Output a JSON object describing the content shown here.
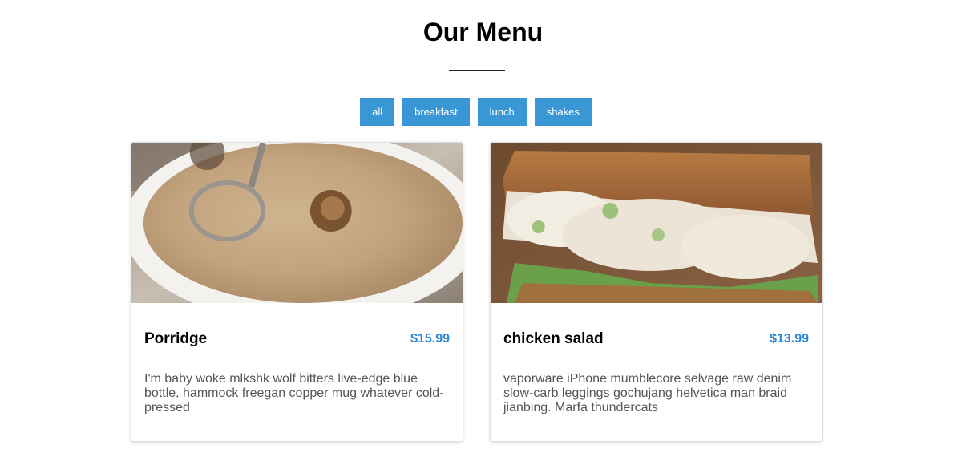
{
  "header": {
    "title": "Our Menu"
  },
  "filters": [
    {
      "label": "all"
    },
    {
      "label": "breakfast"
    },
    {
      "label": "lunch"
    },
    {
      "label": "shakes"
    }
  ],
  "items": [
    {
      "name": "Porridge",
      "price": "$15.99",
      "description": "I'm baby woke mlkshk wolf bitters live-edge blue bottle, hammock freegan copper mug whatever cold-pressed",
      "image": "porridge bowl photo"
    },
    {
      "name": "chicken salad",
      "price": "$13.99",
      "description": "vaporware iPhone mumblecore selvage raw denim slow-carb leggings gochujang helvetica man braid jianbing. Marfa thundercats",
      "image": "chicken salad sandwich photo"
    }
  ],
  "colors": {
    "filter_button": "#3a97d6",
    "price": "#2b86d6"
  }
}
